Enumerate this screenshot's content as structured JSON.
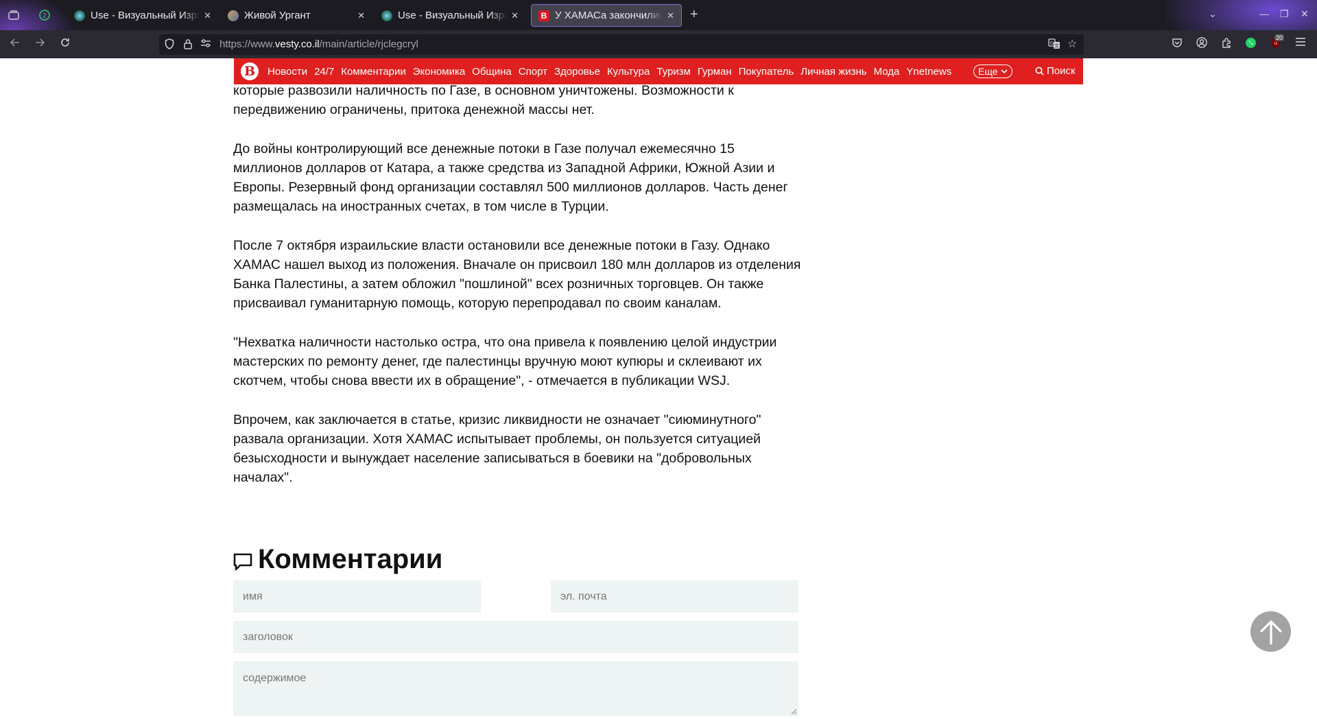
{
  "browser": {
    "tabs": [
      {
        "label": "Use - Визуальный Израиль"
      },
      {
        "label": "Живой Ургант"
      },
      {
        "label": "Use - Визуальный Израиль"
      },
      {
        "label": "У ХАМАСа закончились деньги"
      }
    ],
    "url_prefix": "https://www.",
    "url_domain": "vesty.co.il",
    "url_path": "/main/article/rjclegcryl",
    "extension_badge": "20",
    "colors": {
      "tabbar": "#1c1b22",
      "navbar": "#2b2a33",
      "active_tab_border": "#8a6ad6"
    }
  },
  "site": {
    "logo_letter": "B",
    "nav_items": [
      "Новости",
      "24/7",
      "Комментарии",
      "Экономика",
      "Община",
      "Спорт",
      "Здоровье",
      "Культура",
      "Туризм",
      "Гурман",
      "Покупатель",
      "Личная жизнь",
      "Мода",
      "Ynetnews"
    ],
    "more_label": "Еще",
    "search_label": "Поиск",
    "brand_color": "#e02020"
  },
  "article": {
    "paragraphs": [
      "которые развозили наличность по Газе, в основном уничтожены. Возможности к передвижению ограничены, притока денежной массы нет.",
      "До войны контролирующий все денежные потоки в Газе получал ежемесячно 15 миллионов долларов от Катара, а также средства из Западной Африки, Южной Азии и Европы. Резервный фонд организации составлял 500 миллионов долларов. Часть денег размещалась на иностранных счетах, в том числе в Турции.",
      "После 7 октября израильские власти остановили все денежные потоки в Газу. Однако ХАМАС нашел выход из положения. Вначале он присвоил 180 млн долларов из отделения Банка Палестины, а затем обложил \"пошлиной\" всех розничных торговцев. Он также присваивал гуманитарную помощь, которую перепродавал по своим каналам.",
      "\"Нехватка наличности настолько остра, что она привела к появлению целой индустрии мастерских по ремонту денег, где палестинцы вручную моют купюры и склеивают их скотчем, чтобы снова ввести их в обращение\", - отмечается в публикации WSJ.",
      "Впрочем, как заключается в статье, кризис ликвидности не означает \"сиюминутного\" развала организации. Хотя ХАМАС испытывает проблемы, он пользуется ситуацией безысходности и вынуждает население записываться в боевики на \"добровольных началах\"."
    ]
  },
  "comments": {
    "title": "Комментарии",
    "name_placeholder": "имя",
    "email_placeholder": "эл. почта",
    "subject_placeholder": "заголовок",
    "content_placeholder": "содержимое"
  }
}
